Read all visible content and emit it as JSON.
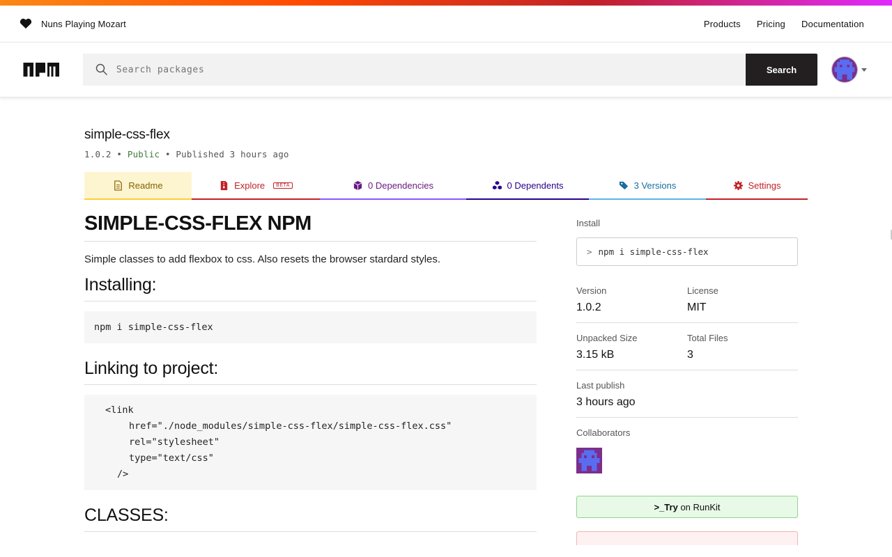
{
  "header": {
    "org_name": "Nuns Playing Mozart",
    "nav": [
      "Products",
      "Pricing",
      "Documentation"
    ]
  },
  "search": {
    "placeholder": "Search packages",
    "button_label": "Search"
  },
  "package": {
    "name": "simple-css-flex",
    "version": "1.0.2",
    "visibility": "Public",
    "published": "Published 3 hours ago",
    "separator": "•"
  },
  "tabs": [
    {
      "label": "Readme",
      "color": "#856003",
      "bg": "#fdf5d0",
      "border": "#ffcd3a",
      "icon": "document-icon"
    },
    {
      "label": "Explore",
      "badge": "BETA",
      "color": "#c12127",
      "border": "#c12127",
      "icon": "file-zip-icon"
    },
    {
      "label": "0 Dependencies",
      "color": "#8956ff",
      "text_color": "#6b1a85",
      "border": "#8956ff",
      "icon": "box-icon"
    },
    {
      "label": "0 Dependents",
      "color": "#29008a",
      "border": "#29008a",
      "icon": "boxes-icon"
    },
    {
      "label": "3 Versions",
      "color": "#196da0",
      "border": "#59b6e9",
      "icon": "tags-icon"
    },
    {
      "label": "Settings",
      "color": "#c12127",
      "border": "#c12127",
      "icon": "gear-icon"
    }
  ],
  "readme": {
    "title": "SIMPLE-CSS-FLEX NPM",
    "description": "Simple classes to add flexbox to css. Also resets the browser stardard styles.",
    "installing_heading": "Installing:",
    "install_code": "npm i simple-css-flex",
    "linking_heading": "Linking to project:",
    "link_code": [
      "<link",
      "href=\"./node_modules/simple-css-flex/simple-css-flex.css\"",
      "rel=\"stylesheet\"",
      "type=\"text/css\"",
      "/>"
    ],
    "classes_heading": "CLASSES:"
  },
  "sidebar": {
    "install_label": "Install",
    "install_prompt": ">",
    "install_command": "npm i simple-css-flex",
    "version_label": "Version",
    "version_value": "1.0.2",
    "license_label": "License",
    "license_value": "MIT",
    "unpacked_label": "Unpacked Size",
    "unpacked_value": "3.15 kB",
    "files_label": "Total Files",
    "files_value": "3",
    "last_publish_label": "Last publish",
    "last_publish_value": "3 hours ago",
    "collaborators_label": "Collaborators",
    "runkit_prefix": ">_Try",
    "runkit_suffix": "on RunKit"
  }
}
